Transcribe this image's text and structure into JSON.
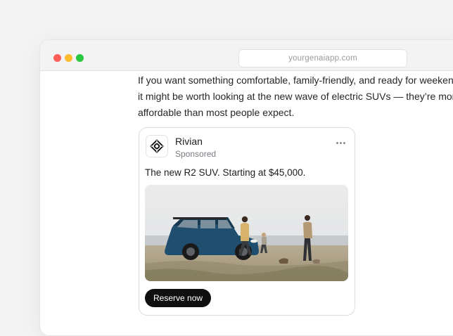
{
  "browser": {
    "url": "yourgenaiapp.com"
  },
  "article": {
    "lines": [
      "If you want something comfortable, family-friendly, and ready for weekend",
      "it might be worth looking at the new wave of electric SUVs — they’re more",
      "affordable than most people expect."
    ]
  },
  "ad": {
    "brand": "Rivian",
    "label": "Sponsored",
    "headline": "The new R2 SUV. Starting at $45,000.",
    "cta_label": "Reserve now",
    "image_icon": "suv-family-beach-photo",
    "menu_icon": "more-horizontal-icon",
    "logo_icon": "rivian-logo-icon"
  },
  "colors": {
    "window_dot_red": "#fe5f57",
    "window_dot_yellow": "#febc2e",
    "window_dot_green": "#28c840",
    "cta_bg": "#0f0f10",
    "suv_body": "#1f4e6e"
  }
}
